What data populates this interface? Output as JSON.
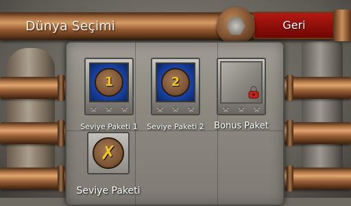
{
  "header": {
    "title": "Dünya Seçimi",
    "back_label": "Geri"
  },
  "packs": [
    {
      "label": "Seviye Paketi 1",
      "number": "1",
      "locked": false,
      "stars": 3
    },
    {
      "label": "Seviye Paketi 2",
      "number": "2",
      "locked": false,
      "stars": 3
    },
    {
      "label": "Bonus Paket",
      "number": "",
      "locked": true,
      "stars": 3
    }
  ],
  "extra_pack": {
    "label": "Seviye Paketi",
    "symbol": "✗"
  },
  "colors": {
    "accent_red": "#9a0f0a",
    "pipe_copper": "#b3784a",
    "dial_number": "#f2c81e",
    "pack_blue": "#1840a0"
  }
}
